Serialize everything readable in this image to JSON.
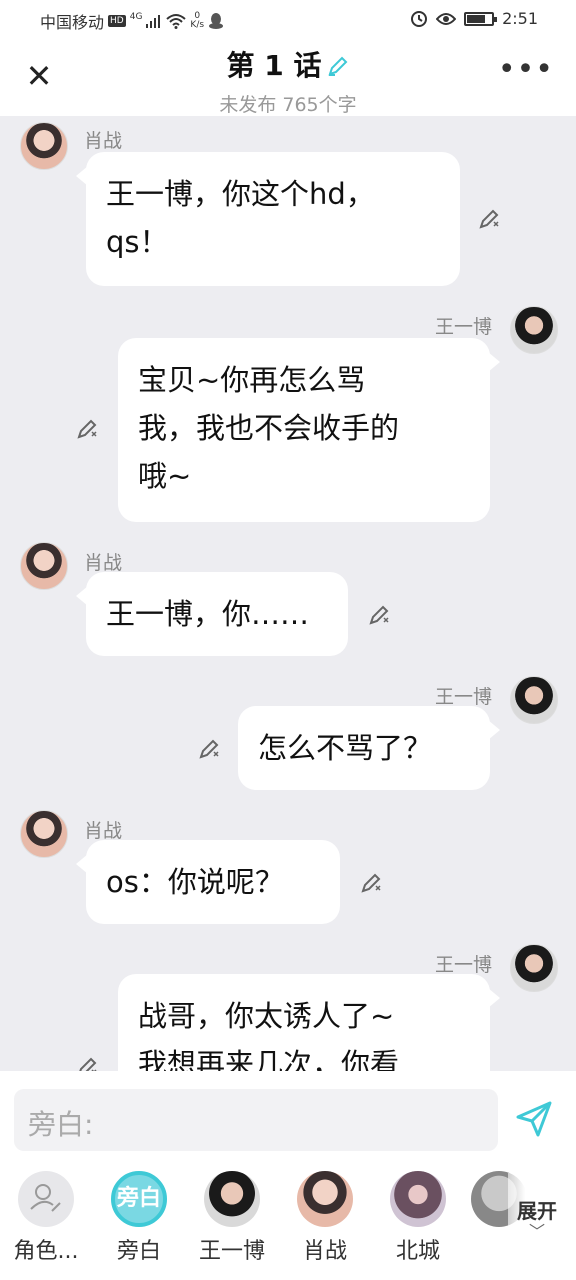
{
  "status": {
    "carrier": "中国移动",
    "hd": "HD",
    "net": "4G",
    "speed_num": "0",
    "speed_unit": "K/s",
    "time": "2:51"
  },
  "header": {
    "title": "第 1 话",
    "subtitle": "未发布 765个字"
  },
  "messages": [
    {
      "side": "left",
      "name": "肖战",
      "lines": [
        "王一博，你这个hd，",
        "qs！"
      ]
    },
    {
      "side": "right",
      "name": "王一博",
      "lines": [
        "宝贝~你再怎么骂",
        "我，我也不会收手的",
        "哦~"
      ]
    },
    {
      "side": "left",
      "name": "肖战",
      "lines": [
        "王一博，你……"
      ]
    },
    {
      "side": "right",
      "name": "王一博",
      "lines": [
        "怎么不骂了？"
      ]
    },
    {
      "side": "left",
      "name": "肖战",
      "lines": [
        "os：你说呢？"
      ]
    },
    {
      "side": "right",
      "name": "王一博",
      "lines": [
        "战哥，你太诱人了~",
        "我想再来几次，你看"
      ]
    }
  ],
  "input": {
    "placeholder": "旁白:"
  },
  "roles": [
    {
      "label": "角色..."
    },
    {
      "label": "旁白",
      "avatar_text": "旁白"
    },
    {
      "label": "王一博"
    },
    {
      "label": "肖战"
    },
    {
      "label": "北城"
    }
  ],
  "expand_label": "展开",
  "colors": {
    "accent": "#3ec9d6",
    "chat_bg": "#ededf1"
  }
}
